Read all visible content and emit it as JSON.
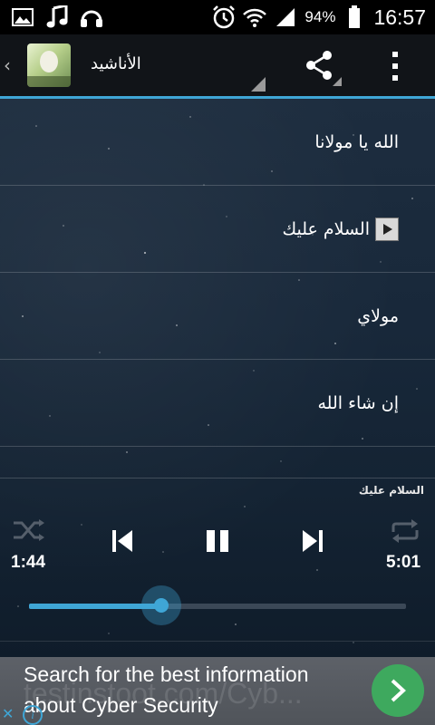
{
  "status_bar": {
    "icons_left": [
      "image-icon",
      "music-note-icon",
      "headphones-icon"
    ],
    "icons_right": [
      "alarm-icon",
      "wifi-icon",
      "signal-icon"
    ],
    "battery": "94%",
    "time": "16:57"
  },
  "action_bar": {
    "back_glyph": "‹",
    "title": "الأناشيد",
    "share_icon": "share-icon",
    "overflow_icon": "more-vert-icon"
  },
  "playlist": [
    {
      "title": "الله يا مولانا",
      "playing": false
    },
    {
      "title": "السلام عليك",
      "playing": true
    },
    {
      "title": "مولاي",
      "playing": false
    },
    {
      "title": "إن شاء الله",
      "playing": false
    }
  ],
  "player": {
    "now_playing": "السلام عليك",
    "elapsed": "1:44",
    "duration": "5:01",
    "progress": 0.35,
    "accent": "#3fa6d6"
  },
  "ad": {
    "line1": "Search for the best information",
    "line2": "about Cyber Security",
    "background_text": "testinstoot.com/Cyb...",
    "button_color": "#3ea95e"
  }
}
